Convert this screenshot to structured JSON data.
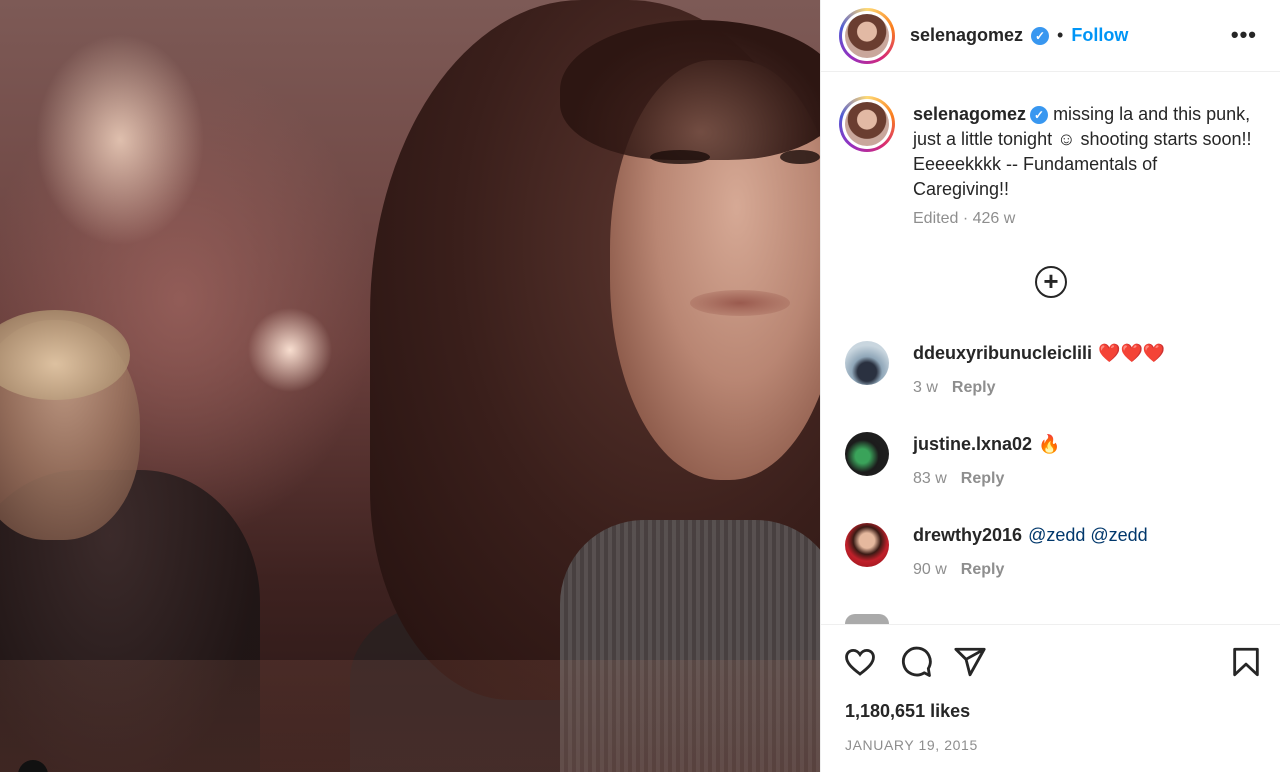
{
  "post": {
    "author": "selenagomez",
    "follow_label": "Follow",
    "separator": "•",
    "more_label": "•••",
    "verified_mark": "✓",
    "caption": "missing la and this punk, just a little tonight ☺ shooting starts soon!! Eeeeekkkk -- Fundamentals of Caregiving!!",
    "meta": "Edited · 426 w",
    "add_label": "+"
  },
  "comments": [
    {
      "user": "ddeuxyribunucleiclili",
      "text": "❤️❤️❤️",
      "time": "3 w",
      "reply": "Reply"
    },
    {
      "user": "justine.lxna02",
      "text": "🔥",
      "time": "83 w",
      "reply": "Reply"
    },
    {
      "user": "drewthy2016",
      "text": "@zedd @zedd",
      "time": "90 w",
      "reply": "Reply"
    }
  ],
  "footer": {
    "likes": "1,180,651 likes",
    "date": "JANUARY 19, 2015"
  },
  "icons": [
    "like-icon",
    "comment-icon",
    "share-icon",
    "save-icon",
    "more-icon",
    "add-comment-icon",
    "verified-icon"
  ],
  "colors": {
    "accent": "#0095f6",
    "verified": "#3897f0",
    "mention": "#00376b",
    "muted": "#8e8e8e"
  }
}
